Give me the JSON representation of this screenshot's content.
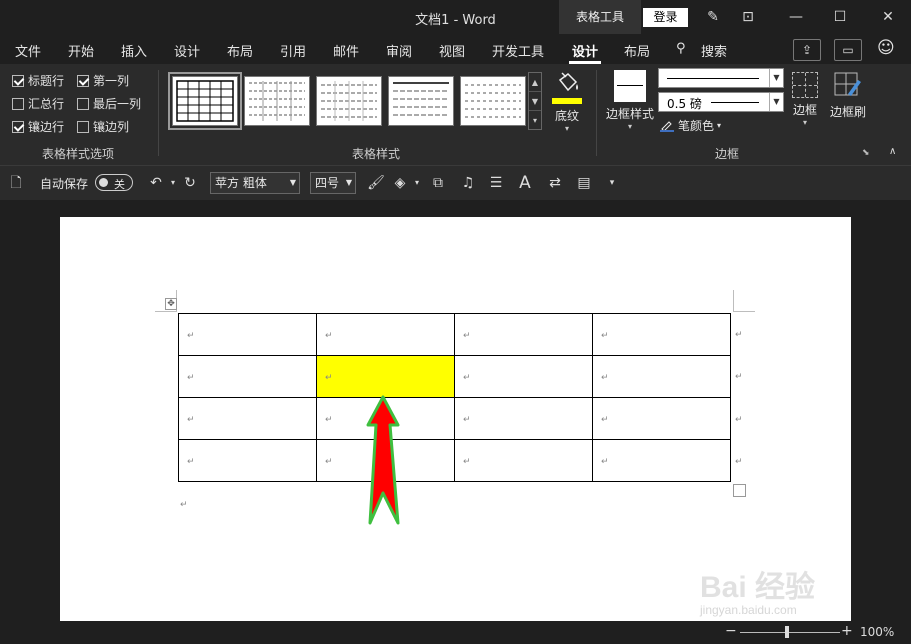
{
  "titlebar": {
    "doc_title": "文档1  -  Word",
    "table_tools": "表格工具",
    "login": "登录"
  },
  "menu": {
    "tabs": [
      "文件",
      "开始",
      "插入",
      "设计",
      "布局",
      "引用",
      "邮件",
      "审阅",
      "视图",
      "开发工具",
      "设计",
      "布局"
    ],
    "search": "搜索",
    "active_tab": "设计"
  },
  "ribbon": {
    "style_options": {
      "items": [
        {
          "label": "标题行",
          "checked": true
        },
        {
          "label": "第一列",
          "checked": true
        },
        {
          "label": "汇总行",
          "checked": false
        },
        {
          "label": "最后一列",
          "checked": false
        },
        {
          "label": "镶边行",
          "checked": true
        },
        {
          "label": "镶边列",
          "checked": false
        }
      ],
      "group_label": "表格样式选项"
    },
    "table_styles": {
      "group_label": "表格样式",
      "shading_label": "底纹",
      "shading_color": "#ffff00"
    },
    "borders": {
      "border_style_label": "边框样式",
      "line_weight": "0.5 磅",
      "pen_color_label": "笔颜色",
      "borders_label": "边框",
      "painter_label": "边框刷",
      "group_label": "边框"
    }
  },
  "qat": {
    "autosave_label": "自动保存",
    "autosave_state": "关",
    "font_name": "苹方 粗体",
    "font_size": "四号"
  },
  "document": {
    "paragraph_mark": "↵",
    "shaded_cell_color": "#ffff00",
    "arrow_color": "#ff0000",
    "arrow_outline_color": "#3fbf3f"
  },
  "status": {
    "zoom_minus": "−",
    "zoom_plus": "+",
    "zoom_level": "100%"
  },
  "watermark": {
    "brand": "Bai 经验",
    "site": "jingyan.baidu.com"
  }
}
